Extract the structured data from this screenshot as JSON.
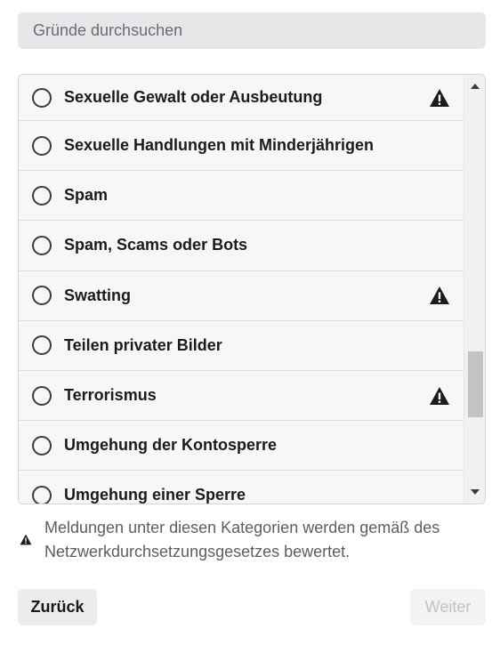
{
  "search": {
    "placeholder": "Gründe durchsuchen",
    "value": ""
  },
  "reasons": [
    {
      "label": "Sexuelle Gewalt oder Ausbeutung",
      "warning": true
    },
    {
      "label": "Sexuelle Handlungen mit Minderjährigen",
      "warning": false
    },
    {
      "label": "Spam",
      "warning": false
    },
    {
      "label": "Spam, Scams oder Bots",
      "warning": false
    },
    {
      "label": "Swatting",
      "warning": true
    },
    {
      "label": "Teilen privater Bilder",
      "warning": false
    },
    {
      "label": "Terrorismus",
      "warning": true
    },
    {
      "label": "Umgehung der Kontosperre",
      "warning": false
    },
    {
      "label": "Umgehung einer Sperre",
      "warning": false
    }
  ],
  "notice": {
    "text": "Meldungen unter diesen Kategorien werden gemäß des Netzwerkdurchsetzungsgesetzes bewertet."
  },
  "buttons": {
    "back": "Zurück",
    "next": "Weiter"
  },
  "icons": {
    "warning": "warning-triangle-icon",
    "scroll_up": "arrow-up-icon",
    "scroll_down": "arrow-down-icon"
  },
  "colors": {
    "text": "#18181b",
    "muted": "#5d5d64",
    "list_bg": "#f7f7f8",
    "search_bg": "#e7e7e9"
  }
}
